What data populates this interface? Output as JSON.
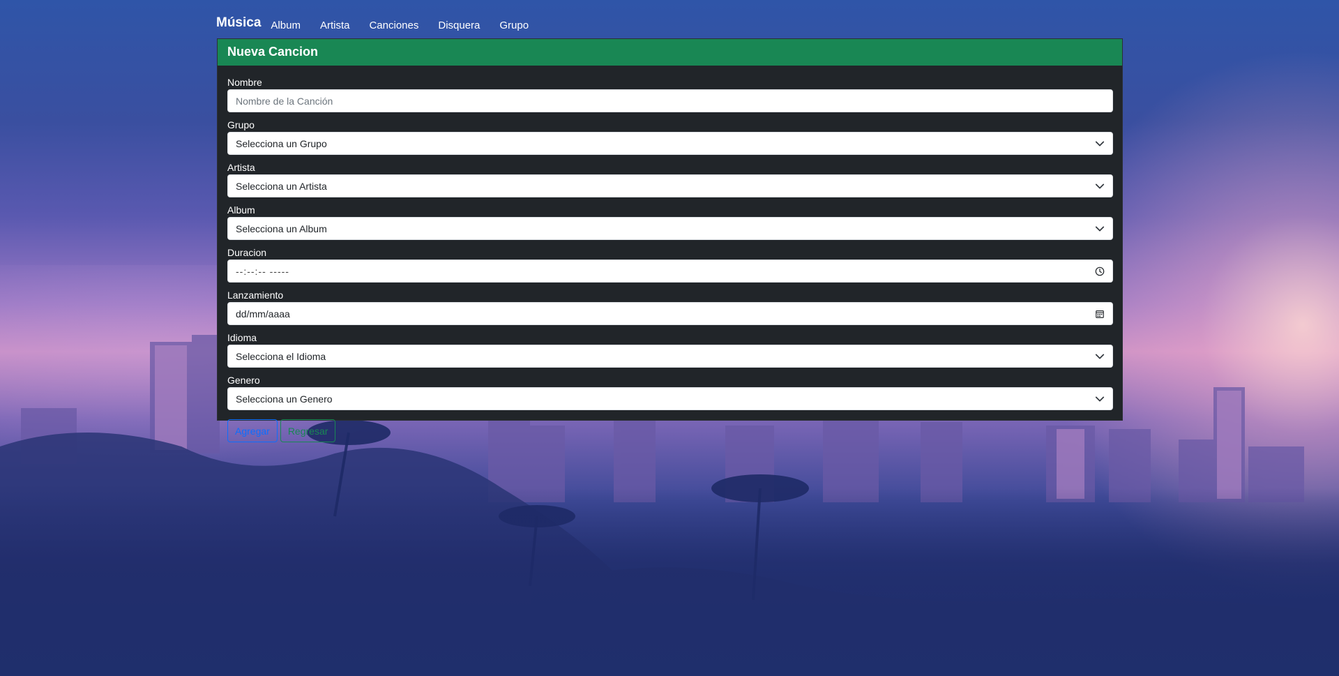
{
  "nav": {
    "brand": "Música",
    "links": [
      "Album",
      "Artista",
      "Canciones",
      "Disquera",
      "Grupo"
    ]
  },
  "form": {
    "title": "Nueva Cancion",
    "fields": {
      "nombre": {
        "label": "Nombre",
        "placeholder": "Nombre de la Canción"
      },
      "grupo": {
        "label": "Grupo",
        "value": "Selecciona un Grupo"
      },
      "artista": {
        "label": "Artista",
        "value": "Selecciona un Artista"
      },
      "album": {
        "label": "Album",
        "value": "Selecciona un Album"
      },
      "duracion": {
        "label": "Duracion",
        "value": "--:--:-- -----"
      },
      "lanzamiento": {
        "label": "Lanzamiento",
        "value": "dd/mm/aaaa"
      },
      "idioma": {
        "label": "Idioma",
        "value": "Selecciona el Idioma"
      },
      "genero": {
        "label": "Genero",
        "value": "Selecciona un Genero"
      }
    },
    "buttons": {
      "submit": "Agregar",
      "back": "Regresar"
    }
  },
  "colors": {
    "header_bg": "#198754",
    "card_bg": "#212529",
    "primary": "#0d6efd",
    "success": "#198754"
  },
  "icons": {
    "select": "chevron-down-icon",
    "time": "clock-icon",
    "date": "calendar-icon"
  }
}
